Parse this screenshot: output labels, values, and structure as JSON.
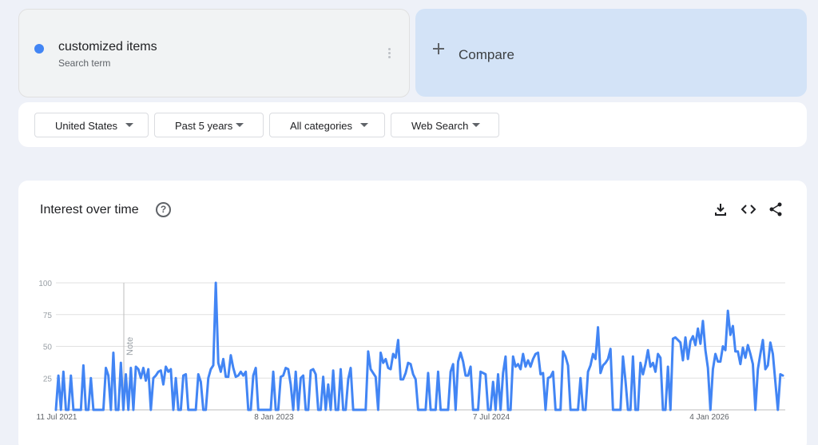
{
  "term": {
    "name": "customized items",
    "subtitle": "Search term",
    "color": "#4285f4"
  },
  "compare": {
    "label": "Compare"
  },
  "filters": [
    {
      "label": "United States"
    },
    {
      "label": "Past 5 years"
    },
    {
      "label": "All categories"
    },
    {
      "label": "Web Search"
    }
  ],
  "panel": {
    "title": "Interest over time",
    "help_icon": "help-circle-icon",
    "tools": [
      "download-icon",
      "embed-code-icon",
      "share-icon"
    ]
  },
  "chart_data": {
    "type": "line",
    "ylim": [
      0,
      100
    ],
    "yticks": [
      25,
      50,
      75,
      100
    ],
    "xtick_labels": [
      "11 Jul 2021",
      "8 Jan 2023",
      "7 Jul 2024",
      "4 Jan 2026"
    ],
    "annotation": "Note",
    "series": [
      {
        "color": "#4285f4",
        "values": [
          0,
          27,
          0,
          30,
          0,
          0,
          27,
          0,
          0,
          0,
          0,
          35,
          0,
          0,
          25,
          0,
          0,
          0,
          0,
          0,
          33,
          27,
          0,
          45,
          0,
          0,
          37,
          0,
          28,
          0,
          33,
          0,
          34,
          32,
          25,
          33,
          23,
          32,
          0,
          25,
          27,
          30,
          31,
          20,
          34,
          30,
          32,
          0,
          25,
          0,
          0,
          27,
          28,
          0,
          0,
          0,
          0,
          28,
          22,
          0,
          0,
          25,
          32,
          35,
          100,
          37,
          30,
          40,
          26,
          26,
          43,
          33,
          26,
          27,
          30,
          27,
          30,
          0,
          0,
          27,
          33,
          0,
          0,
          0,
          0,
          0,
          0,
          30,
          0,
          0,
          26,
          27,
          33,
          32,
          20,
          0,
          30,
          0,
          25,
          27,
          0,
          0,
          31,
          32,
          28,
          0,
          0,
          26,
          0,
          20,
          0,
          31,
          0,
          0,
          32,
          0,
          0,
          24,
          33,
          0,
          0,
          0,
          0,
          0,
          0,
          46,
          32,
          29,
          26,
          0,
          45,
          37,
          40,
          33,
          32,
          44,
          41,
          55,
          24,
          24,
          29,
          37,
          36,
          28,
          24,
          0,
          0,
          0,
          0,
          29,
          0,
          0,
          0,
          30,
          0,
          0,
          0,
          0,
          30,
          36,
          0,
          38,
          45,
          38,
          27,
          27,
          34,
          0,
          0,
          0,
          30,
          29,
          28,
          0,
          0,
          22,
          0,
          28,
          0,
          29,
          42,
          0,
          0,
          42,
          34,
          36,
          32,
          44,
          34,
          39,
          34,
          40,
          44,
          45,
          28,
          29,
          0,
          25,
          26,
          30,
          0,
          0,
          0,
          46,
          42,
          35,
          0,
          0,
          0,
          0,
          25,
          0,
          0,
          30,
          35,
          44,
          40,
          65,
          29,
          35,
          37,
          40,
          48,
          0,
          0,
          0,
          0,
          42,
          23,
          0,
          0,
          42,
          0,
          0,
          37,
          28,
          36,
          47,
          34,
          37,
          30,
          44,
          41,
          0,
          0,
          34,
          0,
          56,
          57,
          55,
          53,
          39,
          57,
          40,
          54,
          58,
          51,
          64,
          52,
          70,
          47,
          33,
          0,
          32,
          44,
          38,
          38,
          50,
          47,
          78,
          59,
          66,
          46,
          46,
          36,
          49,
          41,
          51,
          44,
          36,
          0,
          32,
          44,
          55,
          32,
          35,
          53,
          44,
          22,
          0,
          28,
          27
        ]
      }
    ]
  }
}
